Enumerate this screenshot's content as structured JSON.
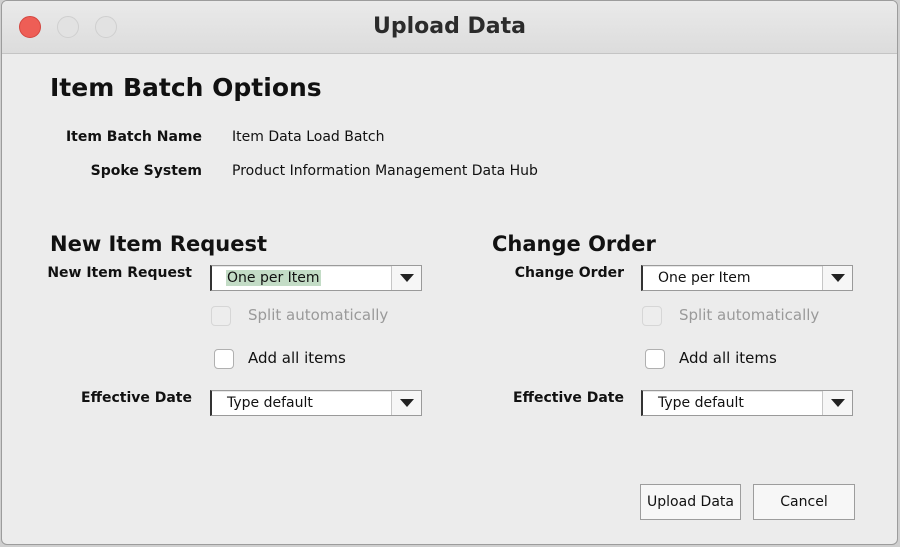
{
  "window": {
    "title": "Upload Data",
    "controls": [
      "close",
      "minimize",
      "zoom"
    ]
  },
  "batch": {
    "heading": "Item Batch Options",
    "name_label": "Item Batch Name",
    "name_value": "Item Data Load Batch",
    "spoke_label": "Spoke System",
    "spoke_value": "Product Information Management Data Hub"
  },
  "new_item_request": {
    "heading": "New Item Request",
    "request_label": "New Item Request",
    "request_value": "One per Item",
    "split_label": "Split automatically",
    "add_all_label": "Add all items",
    "effective_label": "Effective Date",
    "effective_value": "Type default"
  },
  "change_order": {
    "heading": "Change Order",
    "order_label": "Change Order",
    "order_value": "One per Item",
    "split_label": "Split automatically",
    "add_all_label": "Add all items",
    "effective_label": "Effective Date",
    "effective_value": "Type default"
  },
  "buttons": {
    "upload": "Upload Data",
    "cancel": "Cancel"
  },
  "colors": {
    "close_button": "#ee5e56",
    "selection_highlight": "#c3dcc6",
    "window_background": "#ececec"
  }
}
